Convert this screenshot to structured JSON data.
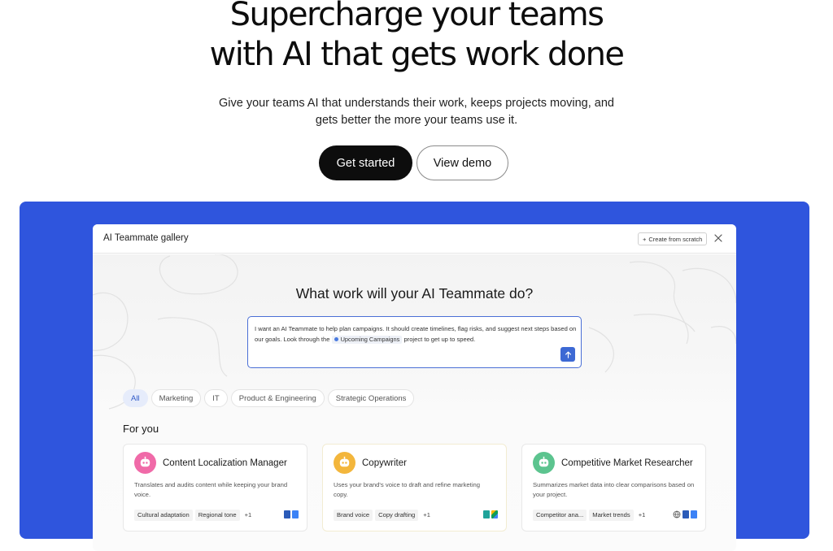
{
  "hero": {
    "title_line1": "Supercharge your teams",
    "title_line2": "with AI that gets work done",
    "subtitle": "Give your teams AI that understands their work, keeps projects moving, and gets better the more your teams use it.",
    "primary_button": "Get started",
    "secondary_button": "View demo"
  },
  "app": {
    "title": "AI Teammate gallery",
    "create_button": "Create from scratch",
    "prompt_heading": "What work will your AI Teammate do?",
    "prompt_text_before": "I want an AI Teammate to help plan campaigns. It should create timelines, flag risks, and suggest next steps based on our goals. Look through the",
    "prompt_chip": "Upcoming Campaigns",
    "prompt_text_after": "project to get up to speed.",
    "filters": [
      "All",
      "Marketing",
      "IT",
      "Product & Engineering",
      "Strategic Operations"
    ],
    "active_filter": "All",
    "section_title": "For you",
    "cards": [
      {
        "title": "Content Localization Manager",
        "description": "Translates and audits content while keeping your brand voice.",
        "tags": [
          "Cultural adaptation",
          "Regional tone"
        ],
        "more": "+1",
        "icon": "robot-face-icon",
        "icon_color": "#f06aa8"
      },
      {
        "title": "Copywriter",
        "description": "Uses your brand's voice to draft and refine marketing copy.",
        "tags": [
          "Brand voice",
          "Copy drafting"
        ],
        "more": "+1",
        "icon": "robot-face-icon",
        "icon_color": "#f3b63c"
      },
      {
        "title": "Competitive Market Researcher",
        "description": "Summarizes market data into clear comparisons based on your project.",
        "tags": [
          "Competitor ana...",
          "Market trends"
        ],
        "more": "+1",
        "icon": "robot-face-icon",
        "icon_color": "#5cc48f"
      }
    ]
  },
  "colors": {
    "panel_blue": "#2f55dd",
    "accent_blue": "#3d69d4",
    "primary_button": "#0d0d0d"
  }
}
